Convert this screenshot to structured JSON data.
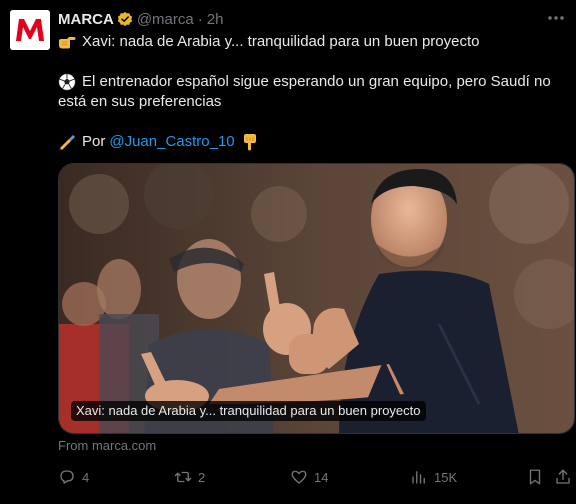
{
  "author": {
    "name": "MARCA",
    "handle": "@marca",
    "separator": "·",
    "time": "2h",
    "avatar_letter": "M"
  },
  "tweet": {
    "line1": "Xavi: nada de Arabia y... tranquilidad para un buen proyecto",
    "line2": "El entrenador español sigue esperando un gran equipo, pero Saudí no",
    "line3": "está en sus preferencias",
    "line4_prefix": "Por",
    "mention": "@Juan_Castro_10"
  },
  "media": {
    "caption": "Xavi: nada de Arabia y... tranquilidad para un buen proyecto"
  },
  "source": "From marca.com",
  "actions": {
    "replies": "4",
    "retweets": "2",
    "likes": "14",
    "views": "15K"
  },
  "icons": {
    "verified": "verified-badge-icon",
    "more": "more-icon",
    "point": "backhand-index-pointing-right-icon",
    "ball": "soccer-ball-icon",
    "writing": "writing-hand-icon",
    "down": "backhand-index-pointing-down-icon",
    "reply": "reply-icon",
    "retweet": "retweet-icon",
    "like": "heart-icon",
    "views": "views-icon",
    "bookmark": "bookmark-icon",
    "share": "share-icon"
  },
  "colors": {
    "background": "#000000",
    "text": "#e7e9ea",
    "muted": "#71767b",
    "link": "#1d9bf0",
    "brand": "#e2001a",
    "verified_gold": "#e8b829"
  }
}
